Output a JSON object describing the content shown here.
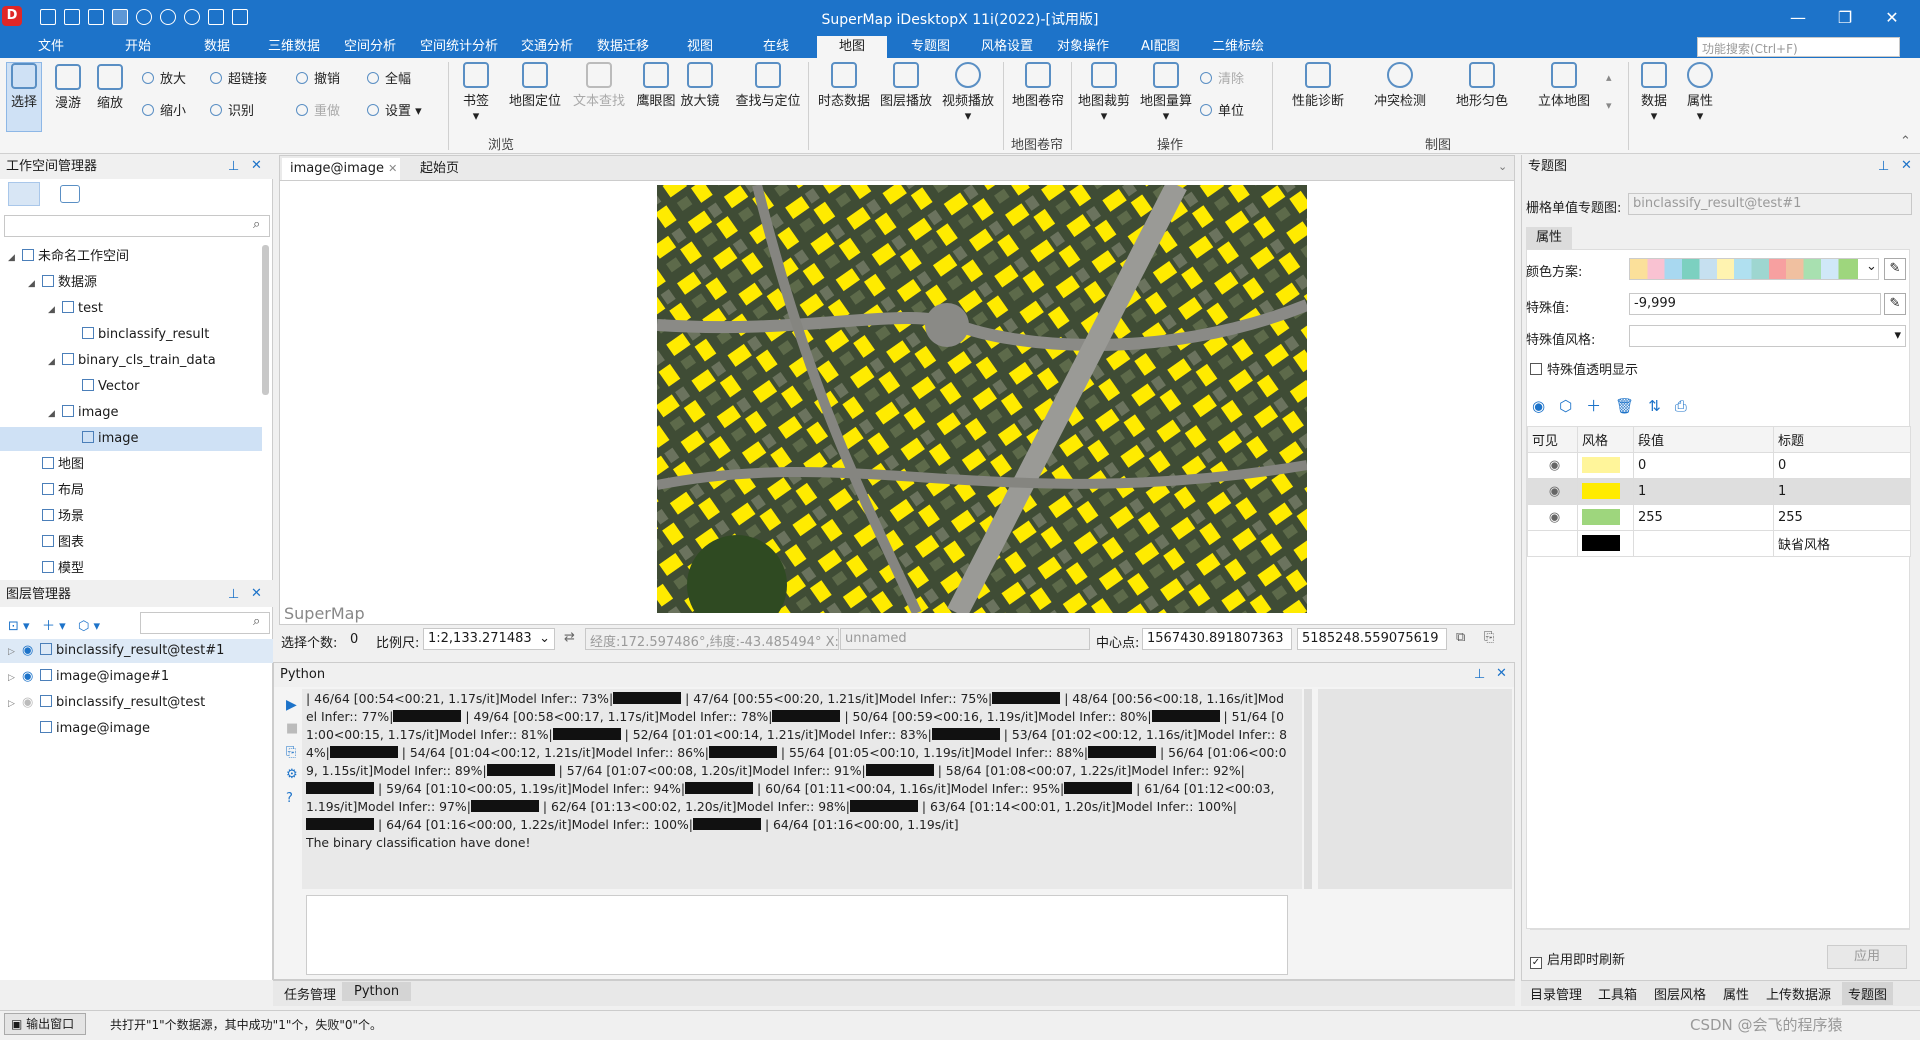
{
  "title": "SuperMap iDesktopX 11i(2022)-[试用版]",
  "menu_tabs": [
    "文件",
    "开始",
    "数据",
    "三维数据",
    "空间分析",
    "空间统计分析",
    "交通分析",
    "数据迁移",
    "视图",
    "在线",
    "地图",
    "专题图",
    "风格设置",
    "对象操作",
    "AI配图",
    "二维标绘"
  ],
  "active_menu_tab": "地图",
  "search_placeholder": "功能搜索(Ctrl+F)",
  "ribbon": {
    "select": "选择",
    "pan": "漫游",
    "zoom": "缩放",
    "zoom_in": "放大",
    "zoom_out": "缩小",
    "hyperlink": "超链接",
    "identify": "识别",
    "undo": "撤销",
    "redo": "重做",
    "full_extent": "全幅",
    "settings": "设置",
    "bookmark": "书签",
    "map_locate": "地图定位",
    "text_find": "文本查找",
    "eagle_eye": "鹰眼图",
    "magnifier": "放大镜",
    "find_locate": "查找与定位",
    "temporal_data": "时态数据",
    "layer_play": "图层播放",
    "video_play": "视频播放",
    "map_roller": "地图卷帘",
    "map_clip": "地图裁剪",
    "map_measure": "地图量算",
    "clear": "清除",
    "unit": "单位",
    "perf_diag": "性能诊断",
    "conflict_detect": "冲突检测",
    "terrain_color": "地形匀色",
    "stereo_map": "立体地图",
    "data": "数据",
    "properties": "属性",
    "group_browse": "浏览",
    "group_roller": "地图卷帘",
    "group_ops": "操作",
    "group_cartography": "制图"
  },
  "workspace": {
    "title": "工作空间管理器",
    "tree": [
      {
        "label": "未命名工作空间",
        "indent": 0,
        "arrow": "◢"
      },
      {
        "label": "数据源",
        "indent": 1,
        "arrow": "◢"
      },
      {
        "label": "test",
        "indent": 2,
        "arrow": "◢"
      },
      {
        "label": "binclassify_result",
        "indent": 3,
        "arrow": ""
      },
      {
        "label": "binary_cls_train_data",
        "indent": 2,
        "arrow": "◢"
      },
      {
        "label": "Vector",
        "indent": 3,
        "arrow": ""
      },
      {
        "label": "image",
        "indent": 2,
        "arrow": "◢"
      },
      {
        "label": "image",
        "indent": 3,
        "arrow": "",
        "selected": true
      },
      {
        "label": "地图",
        "indent": 1,
        "arrow": ""
      },
      {
        "label": "布局",
        "indent": 1,
        "arrow": ""
      },
      {
        "label": "场景",
        "indent": 1,
        "arrow": ""
      },
      {
        "label": "图表",
        "indent": 1,
        "arrow": ""
      },
      {
        "label": "模型",
        "indent": 1,
        "arrow": ""
      }
    ]
  },
  "layers": {
    "title": "图层管理器",
    "items": [
      "binclassify_result@test#1",
      "image@image#1",
      "binclassify_result@test",
      "image@image"
    ]
  },
  "doc_tabs": [
    "image@image",
    "起始页"
  ],
  "watermark": "SuperMap",
  "statusbar": {
    "select_count_label": "选择个数:",
    "select_count": "0",
    "scale_label": "比例尺:",
    "scale": "1:2,133.271483",
    "coords": "经度:172.597486°,纬度:-43.485494°",
    "coord_x": "X:",
    "unnamed": "unnamed",
    "center_label": "中心点:",
    "center_x": "1567430.891807363",
    "center_y": "5185248.559075619"
  },
  "python": {
    "title": "Python",
    "log": [
      "| 46/64 [00:54<00:21,  1.17s/it]Model Infer:: 73%|",
      "| 47/64 [00:55<00:20,  1.21s/it]Model Infer:: 75%|",
      "| 48/64 [00:56<00:18,  1.16s/it]Model Infer:: 77%|",
      "| 49/64 [00:58<00:17,  1.17s/it]Model Infer:: 78%|",
      "| 50/64 [00:59<00:16,  1.19s/it]Model Infer:: 80%|",
      "| 51/64 [01:00<00:15,  1.17s/it]Model Infer:: 81%|",
      "| 52/64 [01:01<00:14,  1.21s/it]Model Infer:: 83%|",
      "| 53/64 [01:02<00:12,  1.16s/it]Model Infer:: 84%|",
      "| 54/64 [01:04<00:12,  1.21s/it]Model Infer:: 86%|",
      "| 55/64 [01:05<00:10,  1.19s/it]Model Infer:: 88%|",
      "| 56/64 [01:06<00:09,  1.15s/it]Model Infer:: 89%|",
      "| 57/64 [01:07<00:08,  1.20s/it]Model Infer:: 91%|",
      "| 58/64 [01:08<00:07,  1.22s/it]Model Infer:: 92%|",
      "| 59/64 [01:10<00:05,  1.19s/it]Model Infer:: 94%|",
      "| 60/64 [01:11<00:04,  1.16s/it]Model Infer:: 95%|",
      "| 61/64 [01:12<00:03,  1.19s/it]Model Infer:: 97%|",
      "| 62/64 [01:13<00:02,  1.20s/it]Model Infer:: 98%|",
      "| 63/64 [01:14<00:01,  1.20s/it]Model Infer:: 100%|",
      "| 64/64 [01:16<00:00,  1.22s/it]Model Infer:: 100%|",
      "| 64/64 [01:16<00:00,  1.19s/it]"
    ],
    "done": "The binary classification have done!"
  },
  "bottom_tabs": [
    "任务管理",
    "Python"
  ],
  "theme": {
    "title": "专题图",
    "raster_label": "栅格单值专题图:",
    "raster_value": "binclassify_result@test#1",
    "prop_tab": "属性",
    "color_scheme_label": "颜色方案:",
    "special_label": "特殊值:",
    "special_value": "-9,999",
    "special_style_label": "特殊值风格:",
    "special_transparent": "特殊值透明显示",
    "cols": [
      "可见",
      "风格",
      "段值",
      "标题"
    ],
    "rows": [
      {
        "value": "0",
        "label": "0",
        "color": "#fff59a"
      },
      {
        "value": "1",
        "label": "1",
        "color": "#ffeb00"
      },
      {
        "value": "255",
        "label": "255",
        "color": "#9ed67d"
      },
      {
        "value": "",
        "label": "缺省风格",
        "color": "#000000"
      }
    ],
    "realtime": "启用即时刷新",
    "apply": "应用"
  },
  "right_tabs": [
    "目录管理",
    "工具箱",
    "图层风格",
    "属性",
    "上传数据源",
    "专题图"
  ],
  "output_window": "输出窗口",
  "status_message": "共打开\"1\"个数据源，其中成功\"1\"个，失败\"0\"个。",
  "footer_watermark": "CSDN @会飞的程序猿"
}
